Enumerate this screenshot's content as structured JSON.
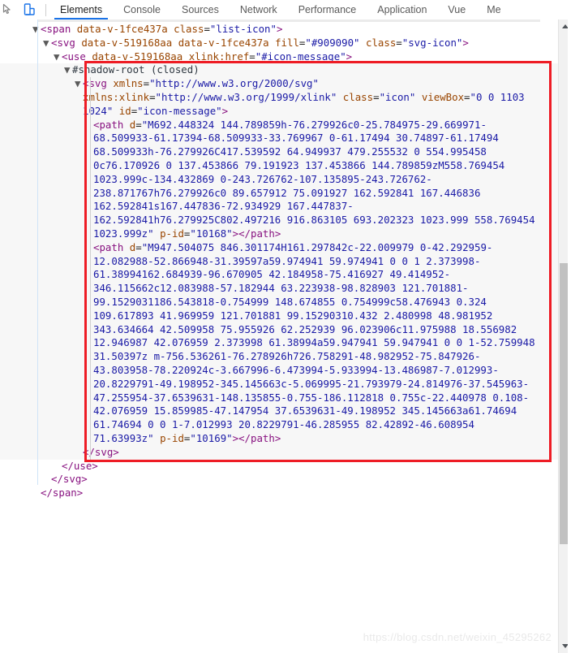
{
  "toolbar": {
    "icons": [
      {
        "name": "inspect-element-icon",
        "label": "inspect"
      },
      {
        "name": "device-toolbar-icon",
        "label": "toggle-device-toolbar"
      }
    ],
    "tabs": [
      {
        "label": "Elements",
        "active": true
      },
      {
        "label": "Console",
        "active": false
      },
      {
        "label": "Sources",
        "active": false
      },
      {
        "label": "Network",
        "active": false
      },
      {
        "label": "Performance",
        "active": false
      },
      {
        "label": "Application",
        "active": false
      },
      {
        "label": "Vue",
        "active": false
      },
      {
        "label": "Me",
        "active": false
      }
    ]
  },
  "code": {
    "lines": [
      {
        "indent": 1,
        "twisty": "down",
        "segments": [
          {
            "t": "<span ",
            "c": "tag"
          },
          {
            "t": "data-v-1fce437a",
            "c": "attr"
          },
          {
            "t": " ",
            "c": "plain"
          },
          {
            "t": "class",
            "c": "attr"
          },
          {
            "t": "=",
            "c": "plain"
          },
          {
            "t": "\"list-icon\"",
            "c": "val"
          },
          {
            "t": ">",
            "c": "tag"
          }
        ]
      },
      {
        "indent": 2,
        "twisty": "down",
        "segments": [
          {
            "t": "<svg ",
            "c": "tag"
          },
          {
            "t": "data-v-519168aa",
            "c": "attr"
          },
          {
            "t": " ",
            "c": "plain"
          },
          {
            "t": "data-v-1fce437a",
            "c": "attr"
          },
          {
            "t": " ",
            "c": "plain"
          },
          {
            "t": "fill",
            "c": "attr"
          },
          {
            "t": "=",
            "c": "plain"
          },
          {
            "t": "\"#909090\"",
            "c": "val"
          },
          {
            "t": " ",
            "c": "plain"
          },
          {
            "t": "class",
            "c": "attr"
          },
          {
            "t": "=",
            "c": "plain"
          },
          {
            "t": "\"svg-icon\"",
            "c": "val"
          },
          {
            "t": ">",
            "c": "tag"
          }
        ]
      },
      {
        "indent": 3,
        "twisty": "down",
        "segments": [
          {
            "t": "<use ",
            "c": "tag"
          },
          {
            "t": "data-v-519168aa",
            "c": "attr"
          },
          {
            "t": " ",
            "c": "plain"
          },
          {
            "t": "xlink:href",
            "c": "attr"
          },
          {
            "t": "=",
            "c": "plain"
          },
          {
            "t": "\"#icon-message\"",
            "c": "val"
          },
          {
            "t": ">",
            "c": "tag"
          }
        ]
      },
      {
        "indent": 4,
        "twisty": "down",
        "shaded": true,
        "segments": [
          {
            "t": "#shadow-root (closed)",
            "c": "shadow"
          }
        ]
      },
      {
        "indent": 5,
        "twisty": "down",
        "shaded": true,
        "segments": [
          {
            "t": "<svg ",
            "c": "tag"
          },
          {
            "t": "xmlns",
            "c": "attr"
          },
          {
            "t": "=",
            "c": "plain"
          },
          {
            "t": "\"http://www.w3.org/2000/svg\"",
            "c": "val"
          },
          {
            "t": " ",
            "c": "plain"
          },
          {
            "t": "xmlns:xlink",
            "c": "attr"
          },
          {
            "t": "=",
            "c": "plain"
          },
          {
            "t": "\"http://www.w3.org/1999/xlink\"",
            "c": "val"
          },
          {
            "t": " ",
            "c": "plain"
          },
          {
            "t": "class",
            "c": "attr"
          },
          {
            "t": "=",
            "c": "plain"
          },
          {
            "t": "\"icon\"",
            "c": "val"
          },
          {
            "t": " ",
            "c": "plain"
          },
          {
            "t": "viewBox",
            "c": "attr"
          },
          {
            "t": "=",
            "c": "plain"
          },
          {
            "t": "\"0 0 1103 1024\"",
            "c": "val"
          },
          {
            "t": " ",
            "c": "plain"
          },
          {
            "t": "id",
            "c": "attr"
          },
          {
            "t": "=",
            "c": "plain"
          },
          {
            "t": "\"icon-message\"",
            "c": "val"
          },
          {
            "t": ">",
            "c": "tag"
          }
        ]
      },
      {
        "indent": 6,
        "twisty": "none",
        "shaded": true,
        "segments": [
          {
            "t": "<path ",
            "c": "tag"
          },
          {
            "t": "d",
            "c": "attr"
          },
          {
            "t": "=",
            "c": "plain"
          },
          {
            "t": "\"M692.448324 144.789859h-76.279926c0-25.784975-29.669971-68.509933-61.17394-68.509933-33.769967 0-61.17494 30.74897-61.17494 68.509933h-76.279926C417.539592 64.949937 479.255532 0 554.995458 0c76.170926 0 137.453866 79.191923 137.453866 144.789859zM558.769454 1023.999c-134.432869 0-243.726762-107.135895-243.726762-238.871767h76.279926c0 89.657912 75.091927 162.592841 167.446836 162.592841s167.447836-72.934929 167.447837-162.592841h76.279925C802.497216 916.863105 693.202323 1023.999 558.769454 1023.999z\"",
            "c": "val"
          },
          {
            "t": " ",
            "c": "plain"
          },
          {
            "t": "p-id",
            "c": "attr"
          },
          {
            "t": "=",
            "c": "plain"
          },
          {
            "t": "\"10168\"",
            "c": "val"
          },
          {
            "t": ">",
            "c": "tag"
          },
          {
            "t": "</path>",
            "c": "tag"
          }
        ]
      },
      {
        "indent": 6,
        "twisty": "none",
        "shaded": true,
        "segments": [
          {
            "t": "<path ",
            "c": "tag"
          },
          {
            "t": "d",
            "c": "attr"
          },
          {
            "t": "=",
            "c": "plain"
          },
          {
            "t": "\"M947.504075 846.301174H161.297842c-22.009979 0-42.292959-12.082988-52.866948-31.39597a59.974941 59.974941 0 0 1 2.373998-61.38994162.684939-96.670905 42.184958-75.416927 49.414952-346.115662c12.083988-57.182944 63.223938-98.828903 121.701881-99.1529031186.543818-0.754999 148.674855 0.754999c58.476943 0.324 109.617893 41.969959 121.701881 99.15290310.432 2.480998 48.981952 343.634664 42.509958 75.955926 62.252939 96.023906c11.975988 18.556982 12.946987 42.076959 2.373998 61.38994a59.947941 59.947941 0 0 1-52.759948 31.50397z m-756.536261-76.278926h726.758291-48.982952-75.847926-43.803958-78.220924c-3.667996-6.473994-5.933994-13.486987-7.012993-20.8229791-49.198952-345.145663c-5.069995-21.793979-24.814976-37.545963-47.255954-37.6539631-148.135855-0.755-186.112818 0.755c-22.440978 0.108-42.076959 15.859985-47.147954 37.6539631-49.198952 345.145663a61.74694 61.74694 0 0 1-7.012993 20.8229791-46.285955 82.42892-46.608954 71.63993z\"",
            "c": "val"
          },
          {
            "t": " ",
            "c": "plain"
          },
          {
            "t": "p-id",
            "c": "attr"
          },
          {
            "t": "=",
            "c": "plain"
          },
          {
            "t": "\"10169\"",
            "c": "val"
          },
          {
            "t": ">",
            "c": "tag"
          },
          {
            "t": "</path>",
            "c": "tag"
          }
        ]
      },
      {
        "indent": 5,
        "twisty": "none",
        "shaded": true,
        "segments": [
          {
            "t": "</svg>",
            "c": "tag"
          }
        ]
      },
      {
        "indent": 3,
        "twisty": "none",
        "segments": [
          {
            "t": "</use>",
            "c": "tag"
          }
        ]
      },
      {
        "indent": 2,
        "twisty": "none",
        "segments": [
          {
            "t": "</svg>",
            "c": "tag"
          }
        ]
      },
      {
        "indent": 1,
        "twisty": "none",
        "segments": [
          {
            "t": "</span>",
            "c": "tag"
          }
        ]
      }
    ]
  },
  "highlight": {
    "color": "#ee1c25",
    "name": "shadow-root-highlight-box"
  },
  "scrollbar": {
    "up_arrow": "scroll-up-arrow",
    "down_arrow": "scroll-down-arrow",
    "thumb": "scroll-thumb"
  },
  "watermark": {
    "text": "https://blog.csdn.net/weixin_45295262"
  }
}
